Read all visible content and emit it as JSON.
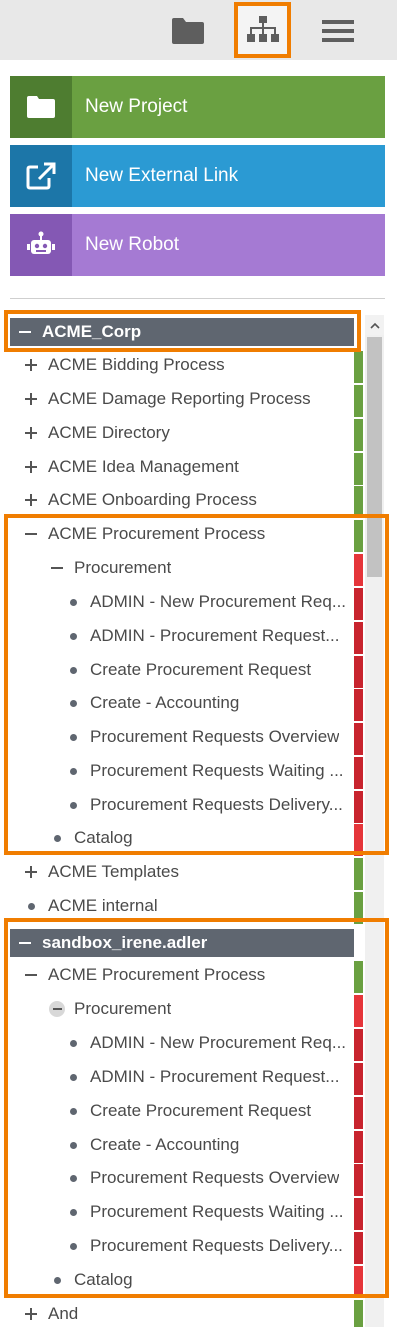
{
  "toolbar": {
    "buttons": [
      {
        "icon": "folder-icon"
      },
      {
        "icon": "sitemap-icon",
        "active": true
      },
      {
        "icon": "hamburger-menu-icon"
      }
    ]
  },
  "actions": {
    "new_project": "New Project",
    "new_external_link": "New External Link",
    "new_robot": "New Robot"
  },
  "colors": {
    "project": "#6aa041",
    "external_link": "#2b9ad3",
    "robot": "#a57ad3",
    "highlight": "#f07d00",
    "status_green": "#6aa041",
    "status_red": "#e5353a"
  },
  "tree": {
    "rows": [
      {
        "label": "ACME_Corp",
        "type": "root"
      },
      {
        "label": "ACME Bidding Process",
        "type": "plus",
        "status": "green"
      },
      {
        "label": "ACME Damage Reporting Process",
        "type": "plus",
        "status": "green"
      },
      {
        "label": "ACME Directory",
        "type": "plus",
        "status": "green"
      },
      {
        "label": "ACME Idea Management",
        "type": "plus",
        "status": "green"
      },
      {
        "label": "ACME Onboarding Process",
        "type": "plus",
        "status": "green"
      },
      {
        "label": "ACME Procurement Process",
        "type": "minus",
        "status": "green"
      },
      {
        "label": "Procurement",
        "type": "minus",
        "status": "red"
      },
      {
        "label": "ADMIN - New Procurement Req...",
        "type": "dot",
        "status": "dred"
      },
      {
        "label": "ADMIN - Procurement Request...",
        "type": "dot",
        "status": "dred"
      },
      {
        "label": "Create Procurement Request",
        "type": "dot",
        "status": "dred"
      },
      {
        "label": "Create - Accounting",
        "type": "dot",
        "status": "dred"
      },
      {
        "label": "Procurement Requests Overview",
        "type": "dot",
        "status": "dred"
      },
      {
        "label": "Procurement Requests Waiting ...",
        "type": "dot",
        "status": "dred"
      },
      {
        "label": "Procurement Requests Delivery...",
        "type": "dot",
        "status": "dred"
      },
      {
        "label": "Catalog",
        "type": "dot",
        "status": "red"
      },
      {
        "label": "ACME Templates",
        "type": "plus",
        "status": "green"
      },
      {
        "label": "ACME internal",
        "type": "dot",
        "status": "green"
      },
      {
        "label": "sandbox_irene.adler",
        "type": "root"
      },
      {
        "label": "ACME Procurement Process",
        "type": "minus",
        "status": "green"
      },
      {
        "label": "Procurement",
        "type": "minus-circle",
        "status": "red"
      },
      {
        "label": "ADMIN - New Procurement Req...",
        "type": "dot",
        "status": "dred"
      },
      {
        "label": "ADMIN - Procurement Request...",
        "type": "dot",
        "status": "dred"
      },
      {
        "label": "Create Procurement Request",
        "type": "dot",
        "status": "dred"
      },
      {
        "label": "Create - Accounting",
        "type": "dot",
        "status": "dred"
      },
      {
        "label": "Procurement Requests Overview",
        "type": "dot",
        "status": "dred"
      },
      {
        "label": "Procurement Requests Waiting ...",
        "type": "dot",
        "status": "dred"
      },
      {
        "label": "Procurement Requests Delivery...",
        "type": "dot",
        "status": "dred"
      },
      {
        "label": "Catalog",
        "type": "dot",
        "status": "red"
      },
      {
        "label": "And",
        "type": "plus",
        "status": "green"
      }
    ]
  }
}
